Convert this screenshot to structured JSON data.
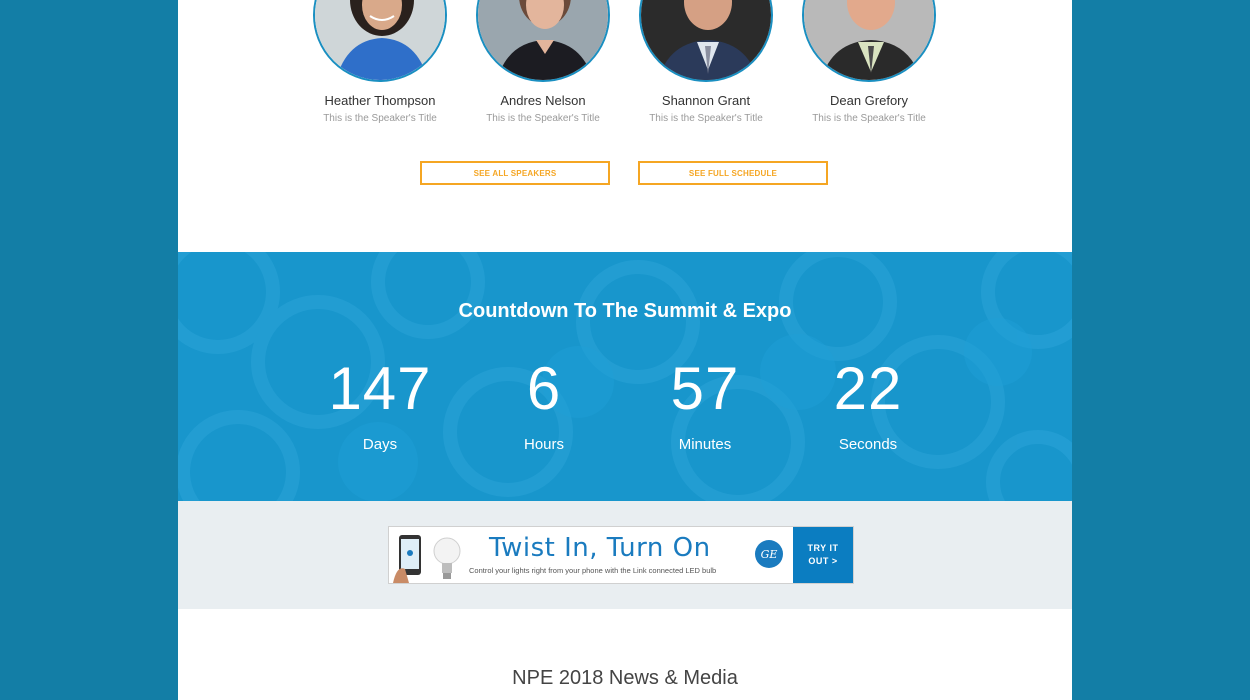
{
  "speakers": [
    {
      "name": "Heather Thompson",
      "title": "This is the Speaker's Title"
    },
    {
      "name": "Andres Nelson",
      "title": "This is the Speaker's Title"
    },
    {
      "name": "Shannon Grant",
      "title": "This is the Speaker's Title"
    },
    {
      "name": "Dean Grefory",
      "title": "This is the Speaker's Title"
    }
  ],
  "buttons": {
    "see_all_speakers": "SEE ALL SPEAKERS",
    "see_full_schedule": "SEE FULL SCHEDULE"
  },
  "countdown": {
    "title": "Countdown To The Summit & Expo",
    "units": [
      {
        "value": "147",
        "label": "Days"
      },
      {
        "value": "6",
        "label": "Hours"
      },
      {
        "value": "57",
        "label": "Minutes"
      },
      {
        "value": "22",
        "label": "Seconds"
      }
    ]
  },
  "ad": {
    "headline": "Twist In, Turn On",
    "subtext": "Control your lights right from your phone with the Link connected LED bulb",
    "cta_line1": "TRY IT",
    "cta_line2": "OUT >",
    "logo_text": "GE"
  },
  "news": {
    "title": "NPE 2018 News & Media"
  },
  "colors": {
    "outer_bg": "#137ea6",
    "countdown_bg": "#1896cc",
    "button_accent": "#f5a623",
    "ad_blue": "#0b7dc1"
  }
}
